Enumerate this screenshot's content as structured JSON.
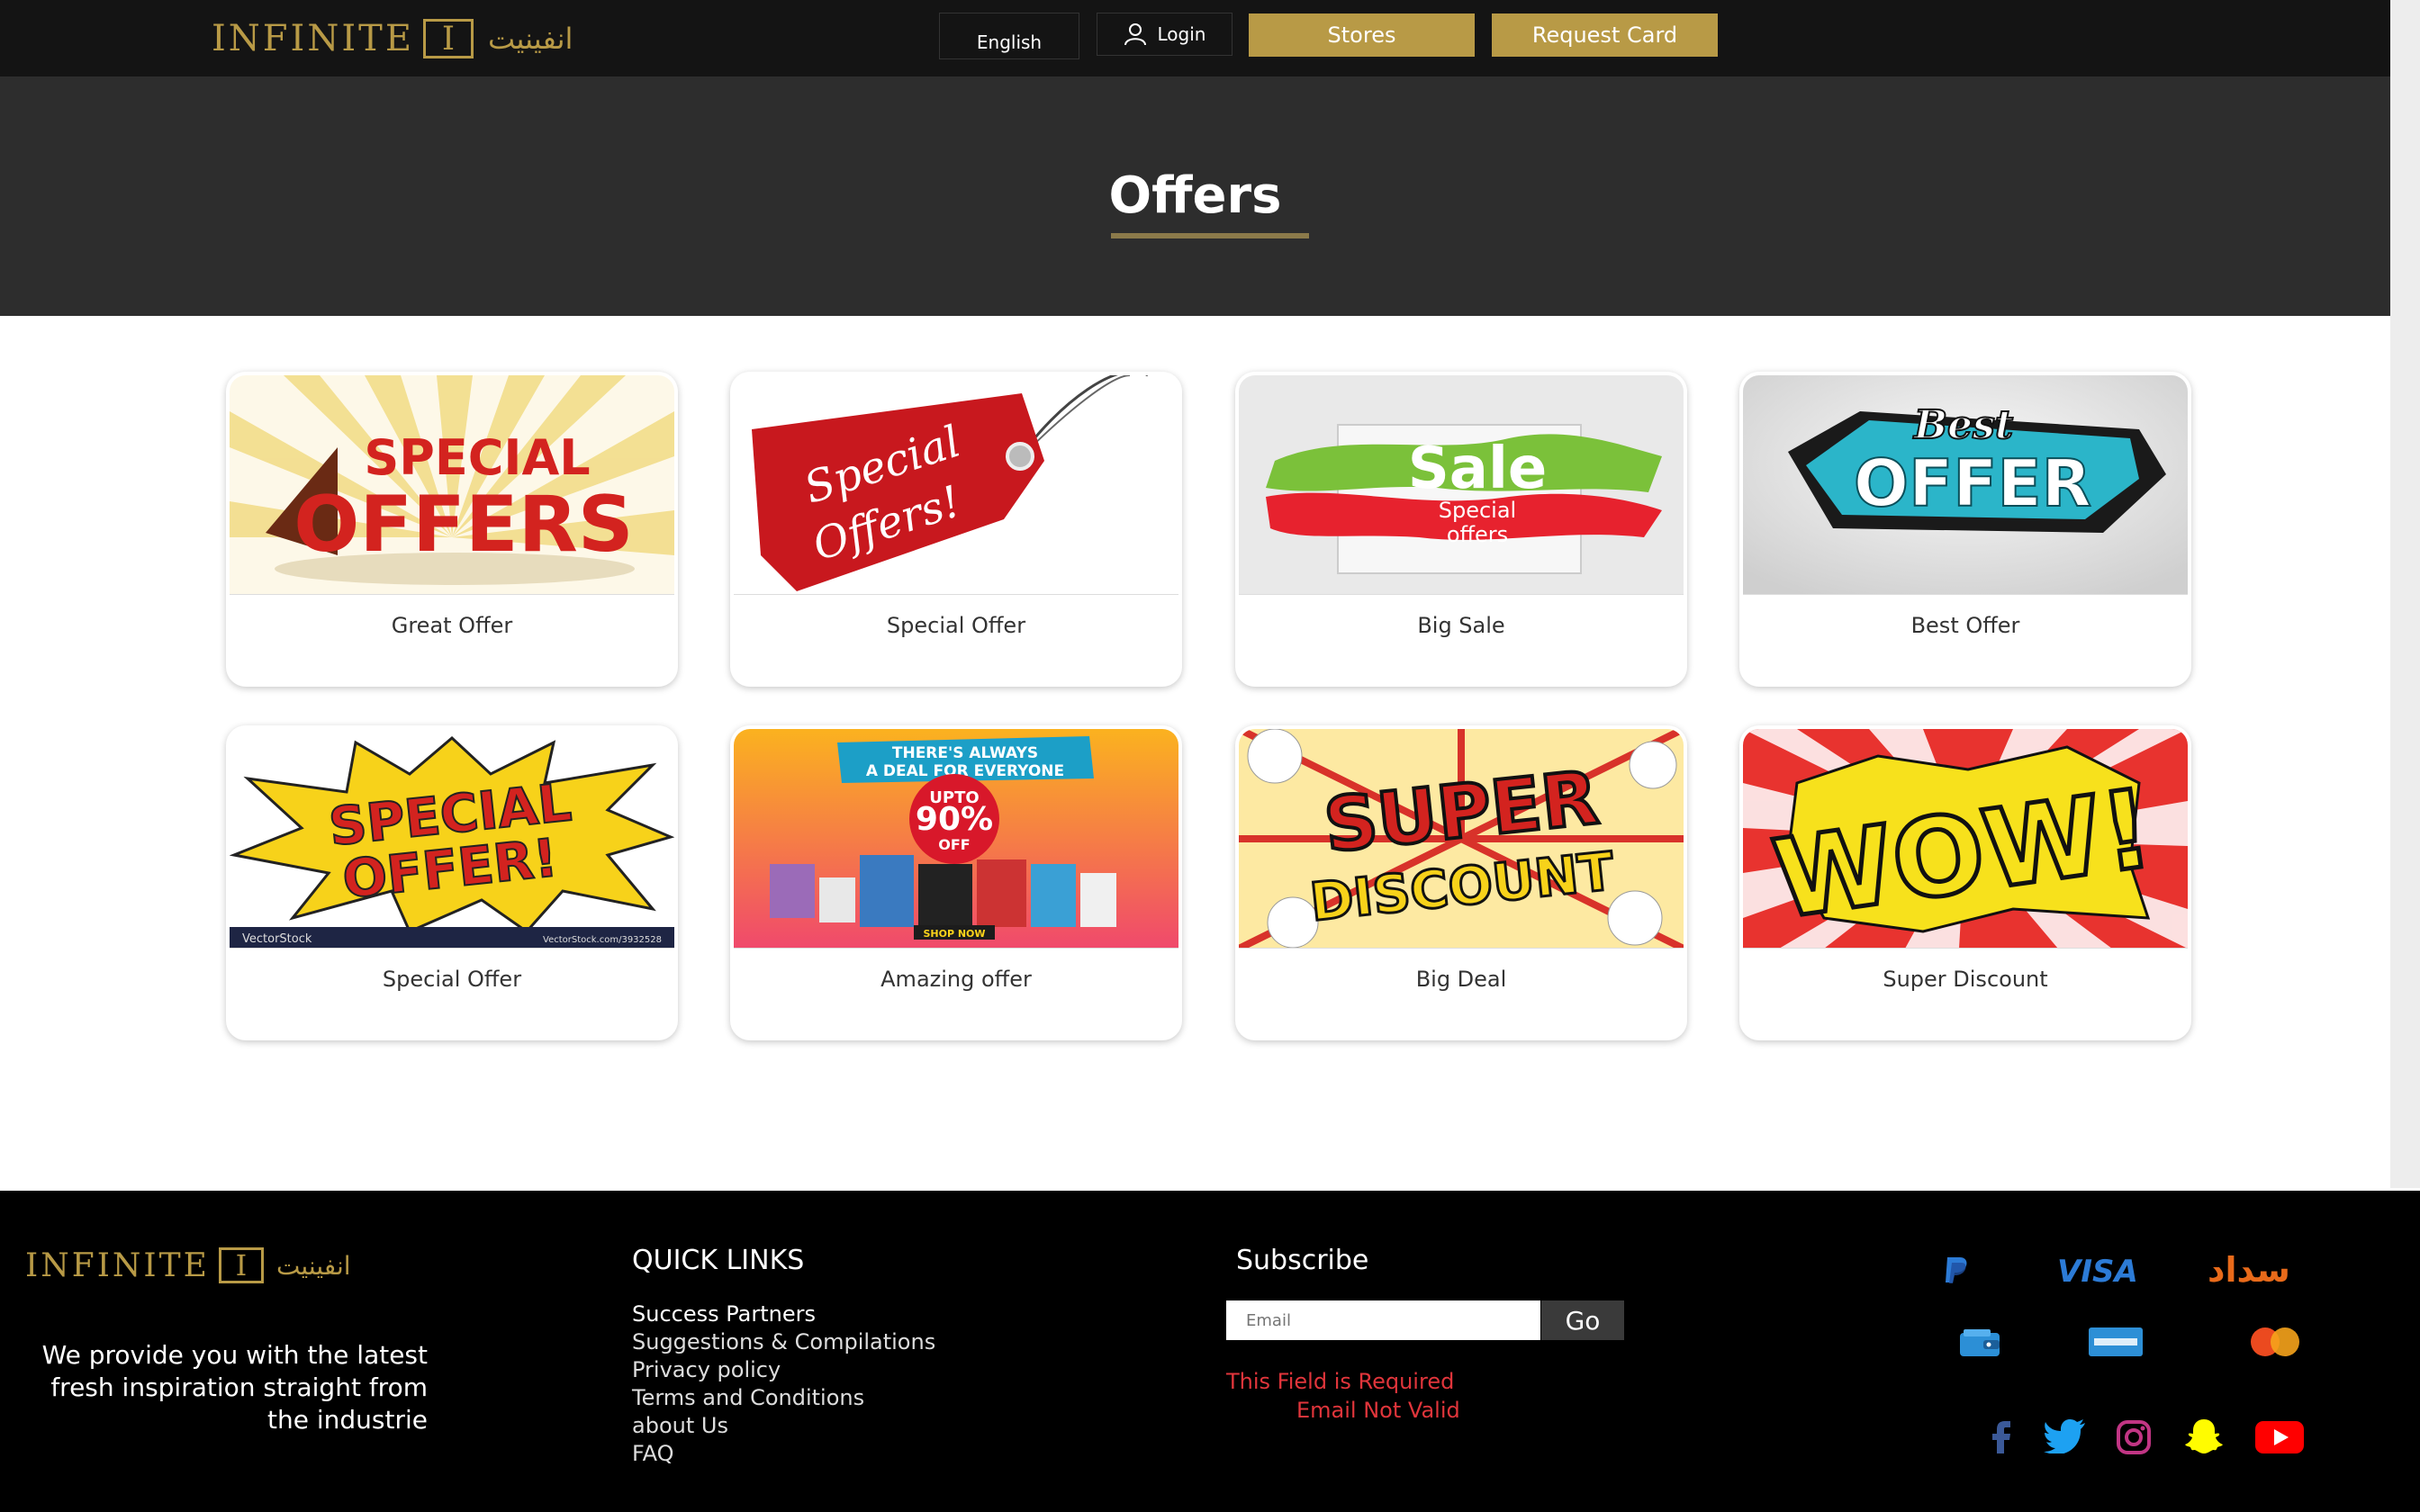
{
  "header": {
    "logo_text": "INFINITE",
    "logo_mark": "I",
    "logo_arabic": "انفينيت",
    "language": "English",
    "login": "Login",
    "stores": "Stores",
    "request_card": "Request Card"
  },
  "hero": {
    "title": "Offers"
  },
  "offers": [
    {
      "title": "Great Offer",
      "image_text": "SPECIAL OFFERS"
    },
    {
      "title": "Special Offer",
      "image_text": "Special Offers!"
    },
    {
      "title": "Big Sale",
      "image_text": "Sale",
      "image_subtext": "Special offers"
    },
    {
      "title": "Best Offer",
      "image_text": "OFFER",
      "image_subtext": "Best"
    },
    {
      "title": "Special Offer",
      "image_text": "SPECIAL OFFER!",
      "image_footer_left": "VectorStock",
      "image_footer_right": "VectorStock.com/3932528"
    },
    {
      "title": "Amazing offer",
      "image_text": "90%",
      "image_banner": "THERE'S ALWAYS A DEAL FOR EVERYONE",
      "image_upto": "UPTO",
      "image_off": "OFF",
      "image_shop": "SHOP NOW"
    },
    {
      "title": "Big Deal",
      "image_text": "SUPER",
      "image_subtext": "DISCOUNT"
    },
    {
      "title": "Super Discount",
      "image_text": "WOW!"
    }
  ],
  "footer": {
    "logo_text": "INFINITE",
    "logo_mark": "I",
    "logo_arabic": "انفينيت",
    "tagline": "We provide you with the latest fresh inspiration straight from the industrie",
    "quick_links_heading": "QUICK LINKS",
    "quick_links": [
      "Success Partners",
      "Suggestions & Compilations",
      "Privacy policy",
      "Terms and Conditions",
      "about Us",
      "FAQ"
    ],
    "subscribe_heading": "Subscribe",
    "email_placeholder": "Email",
    "go": "Go",
    "error_required": "This Field is Required",
    "error_invalid": "Email Not Valid",
    "payments": {
      "visa": "VISA",
      "sadad": "سداد",
      "icons": [
        "paypal-icon",
        "visa-icon",
        "sadad-icon",
        "wallet-icon",
        "amex-icon",
        "mastercard-icon"
      ]
    },
    "social": [
      "facebook-icon",
      "twitter-icon",
      "instagram-icon",
      "snapchat-icon",
      "youtube-icon"
    ]
  },
  "colors": {
    "gold": "#b89a46",
    "header_bg": "#141414",
    "hero_bg": "#2d2d2d",
    "footer_bg": "#000000",
    "error": "#e0353b"
  }
}
